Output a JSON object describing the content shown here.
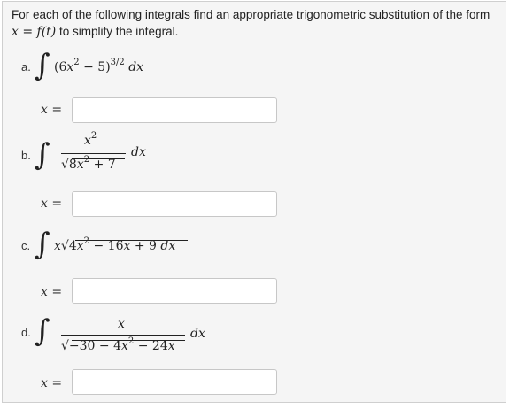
{
  "intro": {
    "text_before": "For each of the following integrals find an appropriate trigonometric substitution of the form ",
    "formula": "x = f(t)",
    "text_after": " to simplify the integral."
  },
  "problems": [
    {
      "label": "a.",
      "integrand_parts": [
        "(6",
        "x",
        "2",
        " − 5)",
        "3/2",
        " d",
        "x"
      ],
      "answer_label": "x =",
      "answer_value": ""
    },
    {
      "label": "b.",
      "numerator": "x²",
      "denominator": "8x² + 7",
      "differential": "dx",
      "answer_label": "x =",
      "answer_value": ""
    },
    {
      "label": "c.",
      "integrand": "x √(4x² − 16x + 9) dx",
      "answer_label": "x =",
      "answer_value": ""
    },
    {
      "label": "d.",
      "numerator": "x",
      "denominator": "−30 − 4x² − 24x",
      "differential": "dx",
      "answer_label": "x =",
      "answer_value": ""
    }
  ]
}
